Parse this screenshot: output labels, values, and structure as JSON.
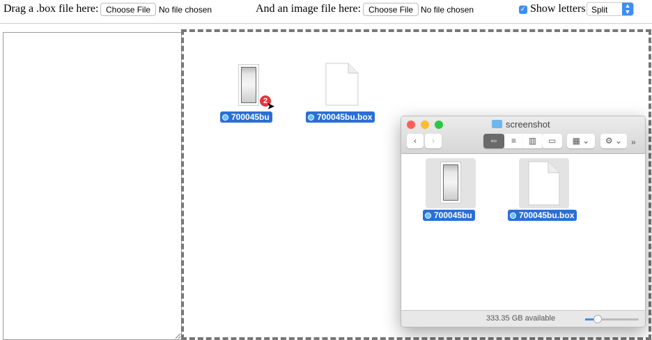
{
  "toolbar": {
    "box_label": "Drag a .box file here:",
    "choose_file": "Choose File",
    "no_file": "No file chosen",
    "image_label": "And an image file here:",
    "show_letters": "Show letters",
    "mode_select": "Split"
  },
  "drag": {
    "image_name": "700045bu",
    "box_name": "700045bu.box",
    "badge_count": "2"
  },
  "finder": {
    "title": "screenshot",
    "files": [
      {
        "name": "700045bu"
      },
      {
        "name": "700045bu.box"
      }
    ],
    "status": "333.35 GB available",
    "view_buttons": [
      "icon",
      "list",
      "column",
      "cover-flow"
    ]
  }
}
